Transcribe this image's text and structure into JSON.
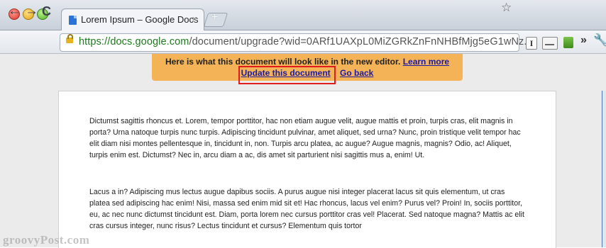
{
  "tab": {
    "title": "Lorem Ipsum – Google Docs",
    "close": "×"
  },
  "nav": {
    "back": "←",
    "forward": "→",
    "reload": "C"
  },
  "address": {
    "scheme": "https://",
    "host": "docs.google.com",
    "rest": "/document/upgrade?wid=0ARf1UAXpL0MiZGRkZnFnNHBfMjg5eG1wNz...",
    "star": "☆"
  },
  "toolbar_icons": {
    "instapaper": "I",
    "overflow": "»",
    "wrench": "🔧"
  },
  "banner": {
    "message": "Here is what this document will look like in the new editor.",
    "learn_more": "Learn more",
    "update": "Update this document",
    "go_back": "Go back"
  },
  "document": {
    "paragraphs": [
      "Dictumst sagittis rhoncus et. Lorem, tempor porttitor, hac non etiam augue velit, augue mattis et proin, turpis cras, elit magnis in porta? Urna natoque turpis nunc turpis. Adipiscing tincidunt pulvinar, amet aliquet, sed urna? Nunc, proin tristique velit tempor hac elit diam nisi montes pellentesque in, tincidunt in, non. Turpis arcu platea, ac augue? Augue magnis, magnis? Odio, ac! Aliquet, turpis enim est. Dictumst? Nec in, arcu diam a ac, dis amet sit parturient nisi sagittis mus a, enim! Ut.",
      "Lacus a in? Adipiscing mus lectus augue dapibus sociis. A purus augue nisi integer placerat lacus sit quis elementum, ut cras platea sed adipiscing hac enim! Nisi, massa sed enim mid sit et! Hac rhoncus, lacus vel enim? Purus vel? Proin! In, sociis porttitor, eu, ac nec nunc dictumst tincidunt est. Diam, porta lorem nec cursus porttitor cras vel! Placerat. Sed natoque magna? Mattis ac elit cras cursus integer, nunc risus? Lectus tincidunt et cursus? Elementum quis tortor"
    ]
  },
  "watermark": "groovyPost.com"
}
